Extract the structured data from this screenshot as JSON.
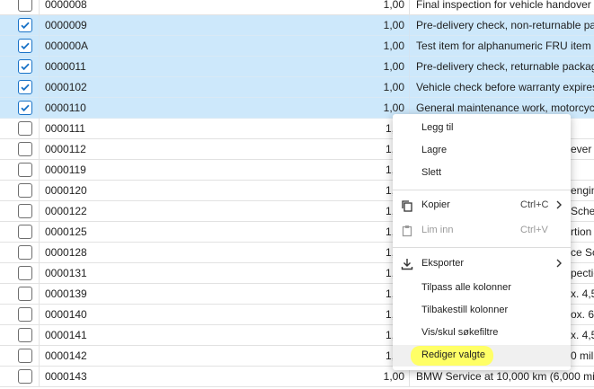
{
  "grid": {
    "rows": [
      {
        "code": "0000008",
        "qty": "1,00",
        "desc": "Final inspection for vehicle handover",
        "selected": false
      },
      {
        "code": "0000009",
        "qty": "1,00",
        "desc": "Pre-delivery check, non-returnable pac",
        "selected": true
      },
      {
        "code": "000000A",
        "qty": "1,00",
        "desc": "Test item for alphanumeric FRU item",
        "selected": true
      },
      {
        "code": "0000011",
        "qty": "1,00",
        "desc": "Pre-delivery check, returnable packag",
        "selected": true
      },
      {
        "code": "0000102",
        "qty": "1,00",
        "desc": "Vehicle check before warranty expires",
        "selected": true
      },
      {
        "code": "0000110",
        "qty": "1,00",
        "desc": "General maintenance work, motorcycl",
        "selected": true
      },
      {
        "code": "0000111",
        "qty": "1,",
        "desc": "",
        "selected": false
      },
      {
        "code": "0000112",
        "qty": "1,",
        "desc": "ever",
        "selected": false
      },
      {
        "code": "0000119",
        "qty": "1,",
        "desc": "",
        "selected": false
      },
      {
        "code": "0000120",
        "qty": "1,",
        "desc": "engin",
        "selected": false
      },
      {
        "code": "0000122",
        "qty": "1,",
        "desc": "Sche",
        "selected": false
      },
      {
        "code": "0000125",
        "qty": "1,",
        "desc": "rtion (",
        "selected": false
      },
      {
        "code": "0000128",
        "qty": "1,",
        "desc": "ce Sc",
        "selected": false
      },
      {
        "code": "0000131",
        "qty": "1,",
        "desc": "pectio",
        "selected": false
      },
      {
        "code": "0000139",
        "qty": "1,",
        "desc": "x. 4,5",
        "selected": false
      },
      {
        "code": "0000140",
        "qty": "1,",
        "desc": "ox. 6",
        "selected": false
      },
      {
        "code": "0000141",
        "qty": "1,",
        "desc": "x. 4,5",
        "selected": false
      },
      {
        "code": "0000142",
        "qty": "1,",
        "desc": "0 mil",
        "selected": false
      },
      {
        "code": "0000143",
        "qty": "1,00",
        "desc": "BMW Service at 10,000 km (6,000 mil",
        "selected": false
      }
    ]
  },
  "context_menu": {
    "add": "Legg til",
    "save": "Lagre",
    "delete": "Slett",
    "copy": "Kopier",
    "copy_shortcut": "Ctrl+C",
    "paste": "Lim inn",
    "paste_shortcut": "Ctrl+V",
    "export": "Eksporter",
    "autosize": "Tilpass alle kolonner",
    "reset_columns": "Tilbakestill kolonner",
    "toggle_filters": "Vis/skul søkefiltre",
    "edit_selected": "Rediger valgte",
    "highlight_color": "#ffff66"
  }
}
